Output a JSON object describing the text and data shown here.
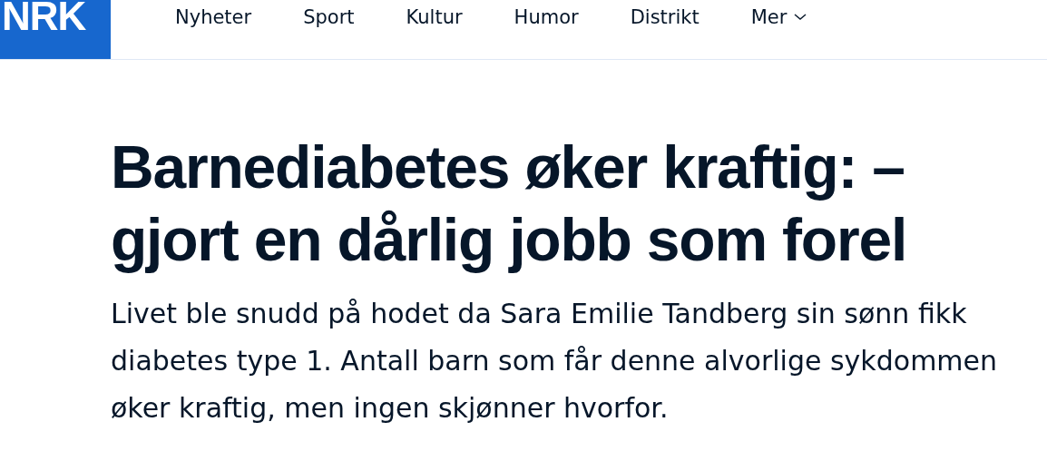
{
  "logo": "NRK",
  "nav": [
    {
      "label": "Nyheter",
      "kind": "link"
    },
    {
      "label": "Sport",
      "kind": "link"
    },
    {
      "label": "Kultur",
      "kind": "link"
    },
    {
      "label": "Humor",
      "kind": "link"
    },
    {
      "label": "Distrikt",
      "kind": "link"
    },
    {
      "label": "Mer",
      "kind": "menu"
    }
  ],
  "headline": [
    "Barnediabetes øker kraftig: –",
    "gjort en dårlig jobb som forel"
  ],
  "lede": "Livet ble snudd på hodet da Sara Emilie Tandberg sin sønn fikk diabetes type 1. Antall barn som får denne alvorlige sykdommen øker kraftig, men ingen skjønner hvorfor."
}
